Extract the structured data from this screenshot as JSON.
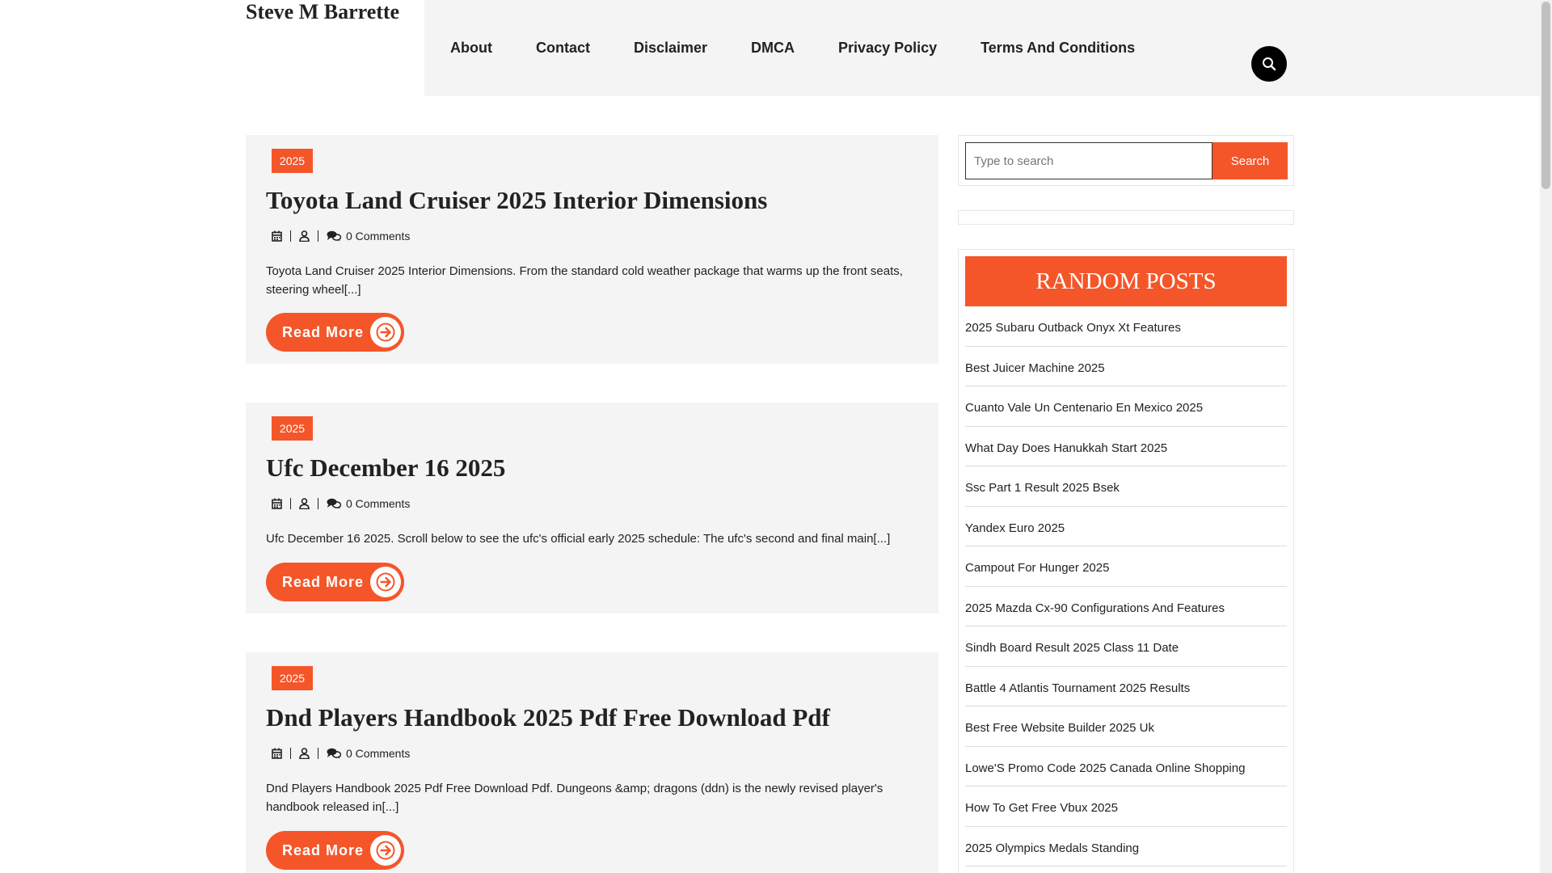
{
  "site": {
    "title": "Steve M Barrette"
  },
  "nav": {
    "items": [
      {
        "label": "About"
      },
      {
        "label": "Contact"
      },
      {
        "label": "Disclaimer"
      },
      {
        "label": "DMCA"
      },
      {
        "label": "Privacy Policy"
      },
      {
        "label": "Terms And Conditions"
      }
    ]
  },
  "header": {
    "search_icon": "search-icon"
  },
  "posts": [
    {
      "category": "2025",
      "title": "Toyota Land Cruiser 2025 Interior Dimensions",
      "comments": "0 Comments",
      "excerpt": "Toyota Land Cruiser 2025 Interior Dimensions. From the standard cold weather package that warms up the front seats, steering wheel[...]",
      "read_more": "Read More"
    },
    {
      "category": "2025",
      "title": "Ufc December 16 2025",
      "comments": "0 Comments",
      "excerpt": "Ufc December 16 2025. Scroll below to see the ufc's official early 2025 schedule: The ufc's second and final main[...]",
      "read_more": "Read More"
    },
    {
      "category": "2025",
      "title": "Dnd Players Handbook 2025 Pdf Free Download Pdf",
      "comments": "0 Comments",
      "excerpt": "Dnd Players Handbook 2025 Pdf Free Download Pdf. Dungeons &amp; dragons (ddn) is the newly revised player's handbook released in[...]",
      "read_more": "Read More"
    }
  ],
  "sidebar": {
    "search": {
      "placeholder": "Type to search",
      "button": "Search"
    },
    "random_posts": {
      "heading": "RANDOM POSTS",
      "items": [
        "2025 Subaru Outback Onyx Xt Features",
        "Best Juicer Machine 2025",
        "Cuanto Vale Un Centenario En Mexico 2025",
        "What Day Does Hanukkah Start 2025",
        "Ssc Part 1 Result 2025 Bsek",
        "Yandex Euro 2025",
        "Campout For Hunger 2025",
        "2025 Mazda Cx-90 Configurations And Features",
        "Sindh Board Result 2025 Class 11 Date",
        "Battle 4 Atlantis Tournament 2025 Results",
        "Best Free Website Builder 2025 Uk",
        "Lowe'S Promo Code 2025 Canada Online Shopping",
        "How To Get Free Vbux 2025",
        "2025 Olympics Medals Standing"
      ]
    }
  },
  "colors": {
    "accent": "#f4562a",
    "panel": "#f4f4f4",
    "text": "#222222"
  }
}
